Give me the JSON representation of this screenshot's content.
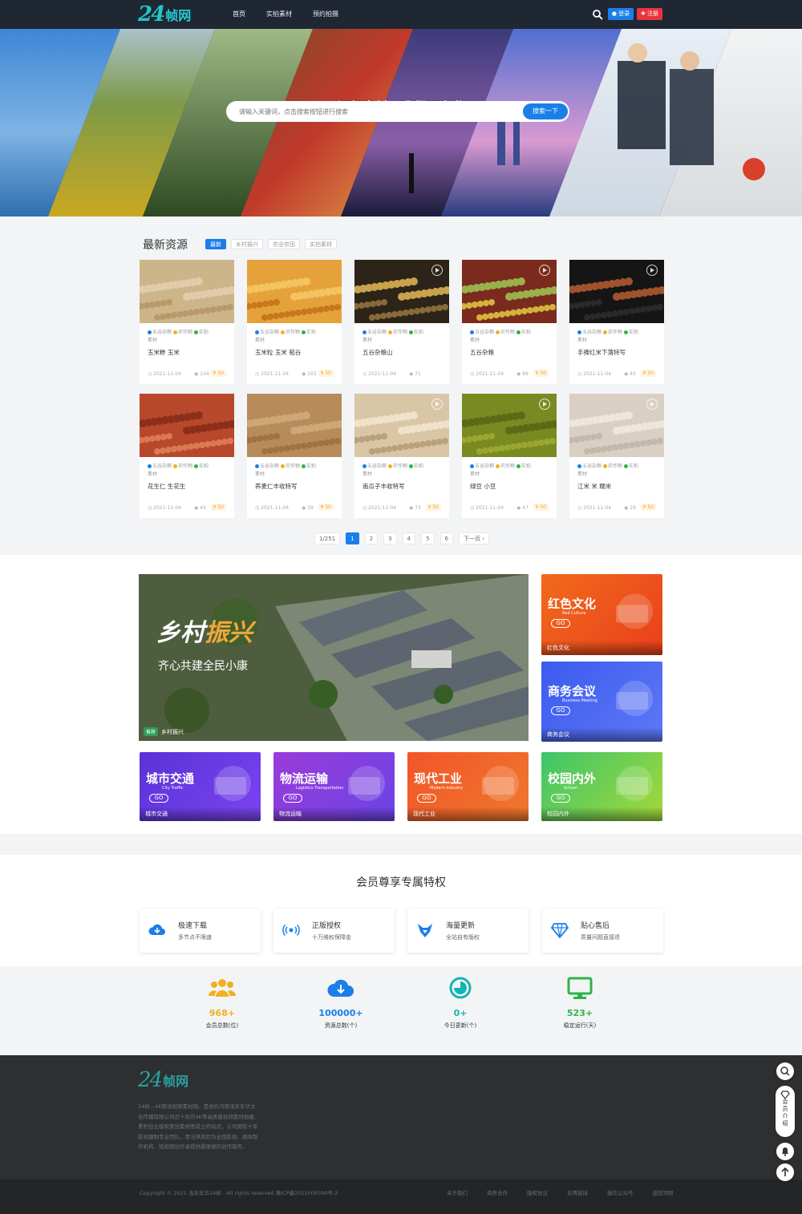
{
  "header": {
    "logo_num": "24",
    "logo_text": "帧网",
    "nav": [
      "首页",
      "实拍素材",
      "预约拍摄"
    ],
    "login": "登录",
    "register": "注册"
  },
  "hero": {
    "title": "视频素材，我们更专业",
    "search_placeholder": "请输入关键词，点击搜索按钮进行搜索",
    "search_button": "搜索一下"
  },
  "latest": {
    "title": "最新资源",
    "filters": [
      "最新",
      "乡村振兴",
      "农业农田",
      "实拍素材"
    ],
    "tag_labels": [
      "五谷杂粮",
      "农作物",
      "实拍",
      "素材"
    ],
    "cards": [
      {
        "name": "玉米糁 玉米",
        "date": "2021-11-04",
        "views": "134",
        "price": "¥ 50"
      },
      {
        "name": "玉米粒 玉米 苞谷",
        "date": "2021-11-04",
        "views": "163",
        "price": "¥ 50"
      },
      {
        "name": "五谷杂粮山",
        "date": "2021-11-04",
        "views": "71",
        "price": ""
      },
      {
        "name": "五谷杂粮",
        "date": "2021-11-04",
        "views": "69",
        "price": "¥ 50"
      },
      {
        "name": "手捧红米下落特写",
        "date": "2021-11-04",
        "views": "40",
        "price": "¥ 50"
      },
      {
        "name": "花生仁 生花生",
        "date": "2021-11-04",
        "views": "44",
        "price": "¥ 50"
      },
      {
        "name": "荞麦仁丰收特写",
        "date": "2021-11-04",
        "views": "39",
        "price": "¥ 50"
      },
      {
        "name": "南瓜子丰收特写",
        "date": "2021-11-04",
        "views": "73",
        "price": "¥ 50"
      },
      {
        "name": "绿豆 小豆",
        "date": "2021-11-04",
        "views": "47",
        "price": "¥ 50"
      },
      {
        "name": "江米 米 糯米",
        "date": "2021-11-04",
        "views": "29",
        "price": "¥ 50"
      }
    ],
    "pager": [
      "1/251",
      "1",
      "2",
      "3",
      "4",
      "5",
      "6",
      "下一页 ›"
    ]
  },
  "banners": {
    "big_title_a": "乡村",
    "big_title_b": "振兴",
    "big_sub": "齐心共建全民小康",
    "big_badge": "推荐",
    "big_label": "乡村振兴",
    "go": "GO",
    "tiles": [
      {
        "title": "红色文化",
        "en": "Red Culture",
        "label": "红色文化",
        "color1": "#f26a1b",
        "color2": "#e8401c"
      },
      {
        "title": "商务会议",
        "en": "Business Meeting",
        "label": "商务会议",
        "color1": "#3b5bef",
        "color2": "#5f78f6"
      },
      {
        "title": "城市交通",
        "en": "City Traffic",
        "label": "城市交通",
        "color1": "#5a32d8",
        "color2": "#7b44f0"
      },
      {
        "title": "物流运输",
        "en": "Logistics Transportation",
        "label": "物流运输",
        "color1": "#9a3bd9",
        "color2": "#6b44e6"
      },
      {
        "title": "现代工业",
        "en": "Modern Industry",
        "label": "现代工业",
        "color1": "#f2552a",
        "color2": "#f0782b"
      },
      {
        "title": "校园内外",
        "en": "School",
        "label": "校园内外",
        "color1": "#3cc56a",
        "color2": "#a6d93a"
      }
    ]
  },
  "privileges": {
    "title": "会员尊享专属特权",
    "items": [
      {
        "title": "极速下载",
        "sub": "多节点不限速"
      },
      {
        "title": "正版授权",
        "sub": "十万维权保障金"
      },
      {
        "title": "海量更新",
        "sub": "全站自有版权"
      },
      {
        "title": "贴心售后",
        "sub": "质量问题直接退"
      }
    ]
  },
  "stats": [
    {
      "num": "968+",
      "label": "会员总数(位)",
      "color": "#f2b01e"
    },
    {
      "num": "100000+",
      "label": "资源总数(个)",
      "color": "#1c7eea"
    },
    {
      "num": "0+",
      "label": "今日更新(个)",
      "color": "#13b5b1"
    },
    {
      "num": "523+",
      "label": "稳定运行(天)",
      "color": "#2fb34a"
    }
  ],
  "footer": {
    "logo_num": "24",
    "logo_text": "帧网",
    "desc": "24帧—4K原创视频素材网。是依托河南浅末年华文化传播有限公司近十年的4K等高质量视频素材拍摄、累积自主版权原创素材而成立的站点。公司拥有十年影视摄制专业团队，零法律风险为全国影视、媒体制作机构、短视频创作者提供最便捷的创作服务。",
    "copyright": "Copyright © 2021  浅末年华24帧 - All rights reserved 豫ICP备2021009390号-2",
    "links": [
      "关于我们",
      "商务合作",
      "版权协议",
      "友情链接",
      "微信公众号",
      "返回顶部"
    ]
  },
  "side": {
    "member_intro": "会员介绍"
  }
}
